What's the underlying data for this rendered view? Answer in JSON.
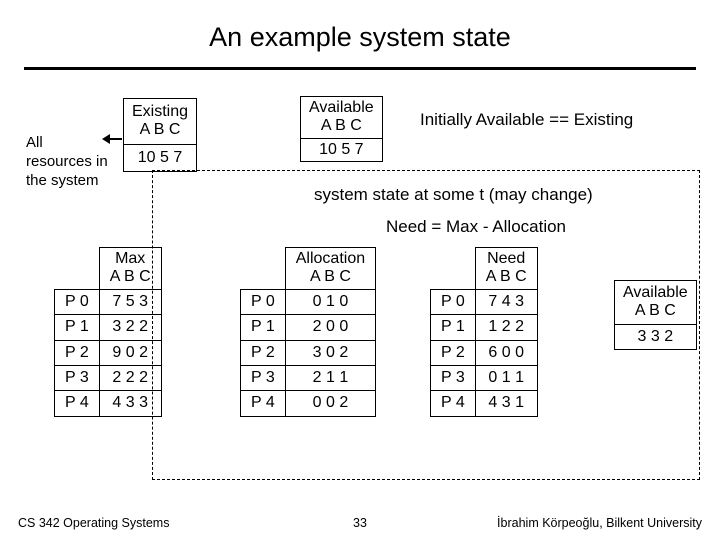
{
  "title": "An example system state",
  "all_resources_label": "All resources in the system",
  "existing": {
    "header_line1": "Existing",
    "header_line2": "A B C",
    "value": "10 5 7"
  },
  "available_top": {
    "header_line1": "Available",
    "header_line2": "A B C",
    "value": "10 5 7"
  },
  "notes": {
    "initially": "Initially Available == Existing",
    "state_at_t": "system state at some t (may change)",
    "need_formula": "Need = Max - Allocation"
  },
  "max": {
    "header_line1": "Max",
    "header_line2": "A B C",
    "rows": [
      {
        "p": "P 0",
        "v": "7 5 3"
      },
      {
        "p": "P 1",
        "v": "3 2 2"
      },
      {
        "p": "P 2",
        "v": "9 0 2"
      },
      {
        "p": "P 3",
        "v": "2 2 2"
      },
      {
        "p": "P 4",
        "v": "4 3 3"
      }
    ]
  },
  "allocation": {
    "header_line1": "Allocation",
    "header_line2": "A B C",
    "rows": [
      {
        "p": "P 0",
        "v": "0 1 0"
      },
      {
        "p": "P 1",
        "v": "2 0 0"
      },
      {
        "p": "P 2",
        "v": "3 0 2"
      },
      {
        "p": "P 3",
        "v": "2 1 1"
      },
      {
        "p": "P 4",
        "v": "0 0 2"
      }
    ]
  },
  "need": {
    "header_line1": "Need",
    "header_line2": "A B C",
    "rows": [
      {
        "p": "P 0",
        "v": "7 4 3"
      },
      {
        "p": "P 1",
        "v": "1 2 2"
      },
      {
        "p": "P 2",
        "v": "6 0 0"
      },
      {
        "p": "P 3",
        "v": "0 1 1"
      },
      {
        "p": "P 4",
        "v": "4 3 1"
      }
    ]
  },
  "available_right": {
    "header_line1": "Available",
    "header_line2": "A B C",
    "value": "3 3 2"
  },
  "footer": {
    "left": "CS 342 Operating Systems",
    "page": "33",
    "right": "İbrahim Körpeoğlu, Bilkent University"
  }
}
